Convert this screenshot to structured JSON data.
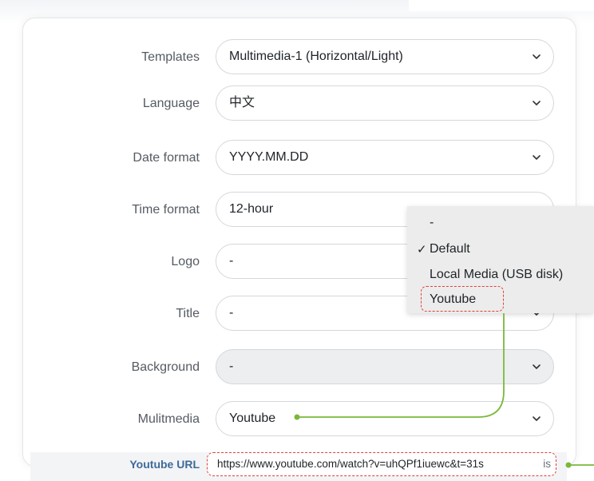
{
  "form": {
    "rows": [
      {
        "label": "Templates",
        "value": "Multimedia-1 (Horizontal/Light)"
      },
      {
        "label": "Language",
        "value": "中文"
      },
      {
        "label": "Date format",
        "value": "YYYY.MM.DD"
      },
      {
        "label": "Time format",
        "value": "12-hour"
      },
      {
        "label": "Logo",
        "value": "-"
      },
      {
        "label": "Title",
        "value": "-"
      },
      {
        "label": "Background",
        "value": "-"
      },
      {
        "label": "Mulitmedia",
        "value": "Youtube"
      }
    ]
  },
  "dropdown": {
    "check_mark": "✓",
    "options": [
      "-",
      "Default",
      "Local Media (USB disk)",
      "Youtube"
    ]
  },
  "youtube_url": {
    "label": "Youtube URL",
    "value": "https://www.youtube.com/watch?v=uhQPf1iuewc&t=31s",
    "suffix": "is"
  },
  "colors": {
    "connector": "#7ab83a",
    "highlight": "#e0403a",
    "label_accent": "#3d6a99"
  },
  "icons": {
    "select_arrow": "chevron-down-icon",
    "selected_option": "checkmark-icon",
    "connector_dot": "connector-dot-icon"
  }
}
